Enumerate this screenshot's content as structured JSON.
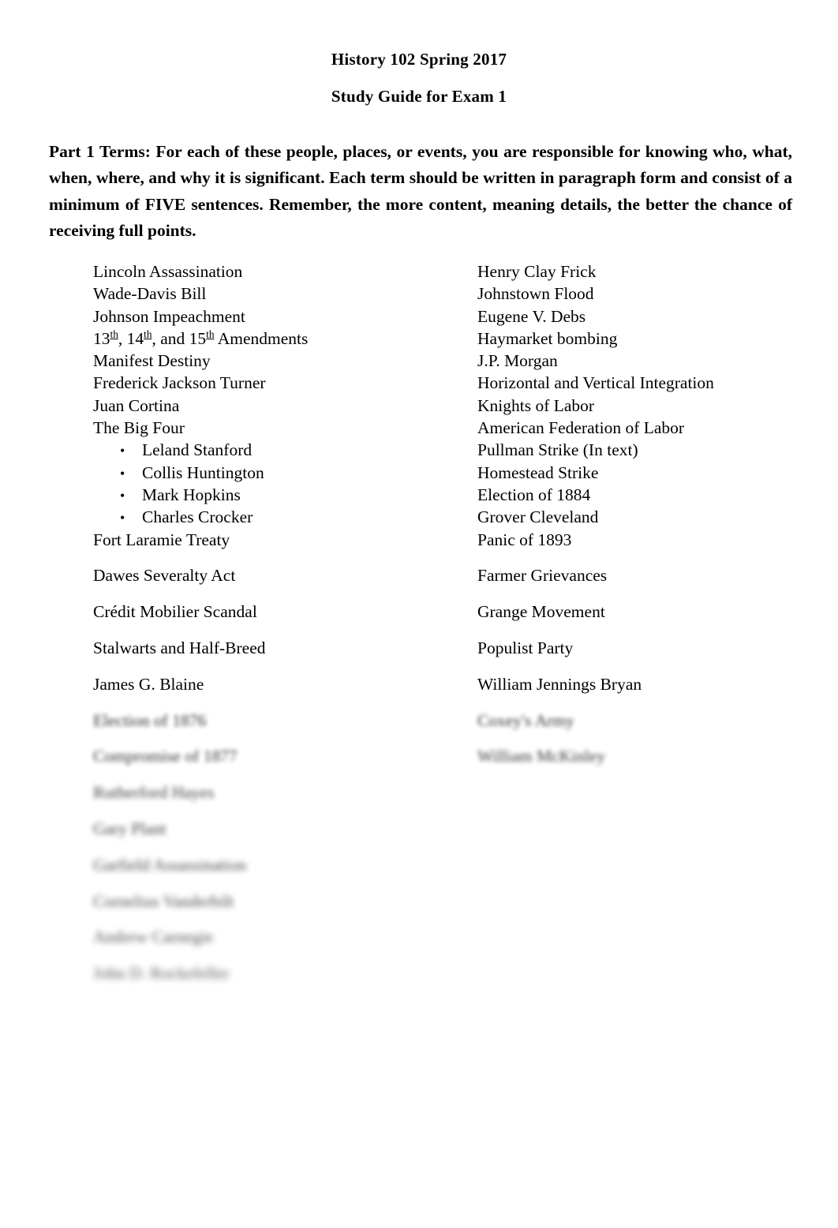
{
  "document": {
    "title_course": "History 102 Spring 2017",
    "title_sub": "Study Guide for Exam 1",
    "intro": "Part 1 Terms:  For each of these people, places, or events, you are responsible for knowing who, what, when, where, and why it is significant.  Each term should be written in paragraph form and consist of a minimum of FIVE sentences.  Remember, the more content, meaning details, the better the chance of receiving full points."
  },
  "terms": {
    "rows": [
      {
        "left": "Lincoln Assassination",
        "right": "Henry Clay Frick",
        "spacing": "tight",
        "blur": 0
      },
      {
        "left": "Wade-Davis Bill",
        "right": "Johnstown Flood",
        "spacing": "tight",
        "blur": 0
      },
      {
        "left": "Johnson Impeachment",
        "right": "Eugene V. Debs",
        "spacing": "tight",
        "blur": 0
      },
      {
        "left": "13th, 14th, and 15th Amendments",
        "left_html": "13<sup>th</sup>, 14<sup>th</sup>, and 15<sup>th</sup> Amendments",
        "right": "Haymarket bombing",
        "spacing": "tight",
        "blur": 0
      },
      {
        "left": "Manifest Destiny",
        "right": "J.P. Morgan",
        "spacing": "tight",
        "blur": 0
      },
      {
        "left": "Frederick Jackson Turner",
        "right": "Horizontal and Vertical Integration",
        "spacing": "tight",
        "blur": 0
      },
      {
        "left": "Juan Cortina",
        "right": "Knights of Labor",
        "spacing": "tight",
        "blur": 0
      },
      {
        "left": "The Big Four",
        "right": "American Federation of Labor",
        "spacing": "tight",
        "blur": 0
      },
      {
        "left": "Leland Stanford",
        "left_bullet": true,
        "right": "Pullman Strike (In text)",
        "spacing": "tight",
        "blur": 0
      },
      {
        "left": "Collis Huntington",
        "left_bullet": true,
        "right": "Homestead Strike",
        "spacing": "tight",
        "blur": 0
      },
      {
        "left": "Mark Hopkins",
        "left_bullet": true,
        "right": "Election of 1884",
        "spacing": "tight",
        "blur": 0
      },
      {
        "left": "Charles Crocker",
        "left_bullet": true,
        "right": "Grover Cleveland",
        "spacing": "tight",
        "blur": 0
      },
      {
        "left": "Fort Laramie Treaty",
        "right": "Panic of 1893",
        "spacing": "loose",
        "blur": 0
      },
      {
        "left": "Dawes Severalty Act",
        "right": "Farmer Grievances",
        "spacing": "loose",
        "blur": 0
      },
      {
        "left": "Crédit Mobilier Scandal",
        "right": "Grange Movement",
        "spacing": "loose",
        "blur": 0
      },
      {
        "left": "Stalwarts and Half-Breed",
        "right": "Populist Party",
        "spacing": "loose",
        "blur": 0
      },
      {
        "left": "James G. Blaine",
        "right": "William Jennings Bryan",
        "spacing": "loose",
        "blur": 0
      },
      {
        "left": "Election of 1876",
        "right": "Coxey's Army",
        "spacing": "loose",
        "blur": 1
      },
      {
        "left": "Compromise of 1877",
        "right": "William McKinley",
        "spacing": "loose",
        "blur": 2
      },
      {
        "left": "Rutherford Hayes",
        "right": "",
        "spacing": "loose",
        "blur": 3
      },
      {
        "left": "Gary Plant",
        "right": "",
        "spacing": "loose",
        "blur": 4
      },
      {
        "left": "Garfield Assassination",
        "right": "",
        "spacing": "loose",
        "blur": 5
      },
      {
        "left": "Cornelius Vanderbilt",
        "right": "",
        "spacing": "loose",
        "blur": 6
      },
      {
        "left": "Andrew Carnegie",
        "right": "",
        "spacing": "loose",
        "blur": 7
      },
      {
        "left": "John D. Rockefeller",
        "right": "",
        "spacing": "loose",
        "blur": 8
      }
    ],
    "bullet_glyph": "•"
  }
}
